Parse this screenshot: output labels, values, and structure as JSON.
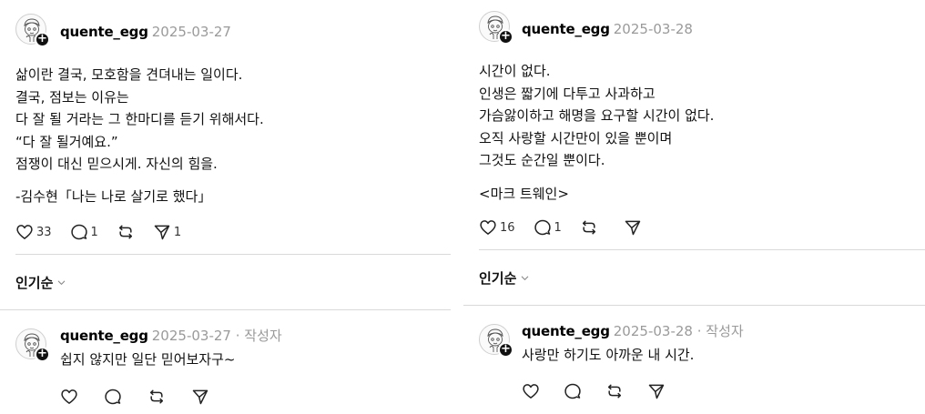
{
  "left": {
    "post": {
      "username": "quente_egg",
      "date": "2025-03-27",
      "lines": [
        "삶이란 결국, 모호함을 견뎌내는 일이다.",
        "결국, 점보는 이유는",
        "다 잘 될 거라는 그 한마디를 듣기 위해서다.",
        "“다 잘 될거예요.”",
        "점쟁이 대신 믿으시게. 자신의 힘을."
      ],
      "quote": "-김수현「나는 나로 살기로 했다」",
      "likes": "33",
      "comments": "1",
      "shares": "1"
    },
    "sort_label": "인기순",
    "reply": {
      "username": "quente_egg",
      "date": "2025-03-27",
      "author_tag": "· 작성자",
      "text": "쉽지 않지만 일단 믿어보자구~"
    }
  },
  "right": {
    "post": {
      "username": "quente_egg",
      "date": "2025-03-28",
      "lines": [
        "시간이 없다.",
        "인생은 짧기에 다투고 사과하고",
        "가슴앓이하고 해명을 요구할 시간이 없다.",
        "오직 사랑할 시간만이 있을 뿐이며",
        "그것도 순간일 뿐이다."
      ],
      "quote": "<마크 트웨인>",
      "likes": "16",
      "comments": "1"
    },
    "sort_label": "인기순",
    "reply": {
      "username": "quente_egg",
      "date": "2025-03-28",
      "author_tag": "· 작성자",
      "text": "사랑만 하기도 아까운 내 시간."
    }
  },
  "icons": {
    "avatar": "avatar-sketch-icon",
    "follow": "plus-icon",
    "like": "heart-icon",
    "comment": "comment-icon",
    "repost": "repost-icon",
    "share": "send-icon",
    "chevron": "chevron-down-icon"
  }
}
